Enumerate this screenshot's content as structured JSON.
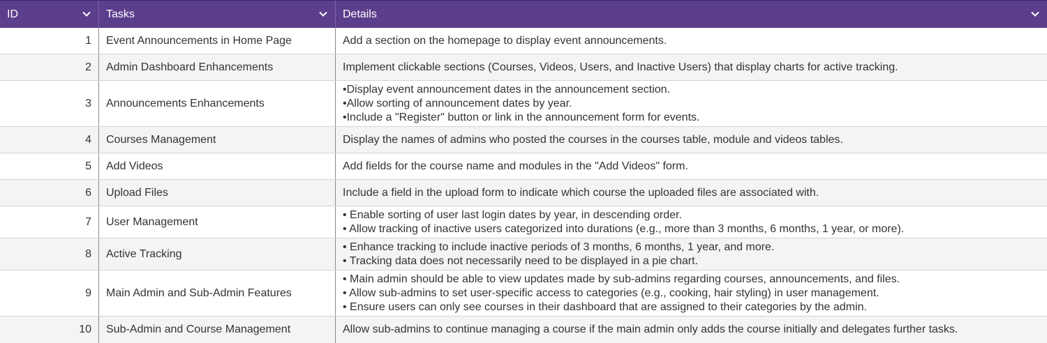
{
  "header": {
    "id_label": "ID",
    "tasks_label": "Tasks",
    "details_label": "Details"
  },
  "colors": {
    "header_bg": "#5b3e8c",
    "header_text": "#ffffff",
    "row_alt_bg": "#f4f4f4"
  },
  "rows": [
    {
      "id": "1",
      "task": "Event Announcements in Home Page",
      "details": [
        "Add a section on the homepage to display event announcements."
      ]
    },
    {
      "id": "2",
      "task": "Admin Dashboard Enhancements",
      "details": [
        "Implement clickable sections (Courses, Videos, Users, and Inactive Users) that display charts for active tracking."
      ]
    },
    {
      "id": "3",
      "task": "Announcements Enhancements",
      "details": [
        "•Display event announcement dates in the announcement section.",
        "•Allow sorting of announcement dates by year.",
        "•Include a \"Register\" button or link in the announcement form for events."
      ]
    },
    {
      "id": "4",
      "task": "Courses Management",
      "details": [
        "Display the names of admins who posted the courses in the courses table, module and videos tables."
      ]
    },
    {
      "id": "5",
      "task": "Add Videos",
      "details": [
        "Add fields for the course name and modules in the \"Add Videos\" form."
      ]
    },
    {
      "id": "6",
      "task": "Upload Files",
      "details": [
        "Include a field in the upload form to indicate which course the uploaded files are associated with."
      ]
    },
    {
      "id": "7",
      "task": "User Management",
      "details": [
        "• Enable sorting of user last login dates by year, in descending order.",
        "• Allow tracking of inactive users categorized into durations (e.g., more than 3 months, 6 months, 1 year, or more)."
      ]
    },
    {
      "id": "8",
      "task": "Active Tracking",
      "details": [
        "• Enhance tracking to include inactive periods of 3 months, 6 months, 1 year, and more.",
        "• Tracking data does not necessarily need to be displayed in a pie chart."
      ]
    },
    {
      "id": "9",
      "task": "Main Admin and Sub-Admin Features",
      "details": [
        "• Main admin should be able to view updates made by sub-admins regarding courses, announcements, and files.",
        "• Allow sub-admins to set user-specific access to categories (e.g., cooking, hair styling) in user management.",
        "• Ensure users can only see courses in their dashboard that are assigned to their categories by the admin."
      ]
    },
    {
      "id": "10",
      "task": "Sub-Admin and Course Management",
      "details": [
        "Allow sub-admins to continue managing a course if the main admin only adds the course initially and delegates further tasks."
      ]
    }
  ]
}
